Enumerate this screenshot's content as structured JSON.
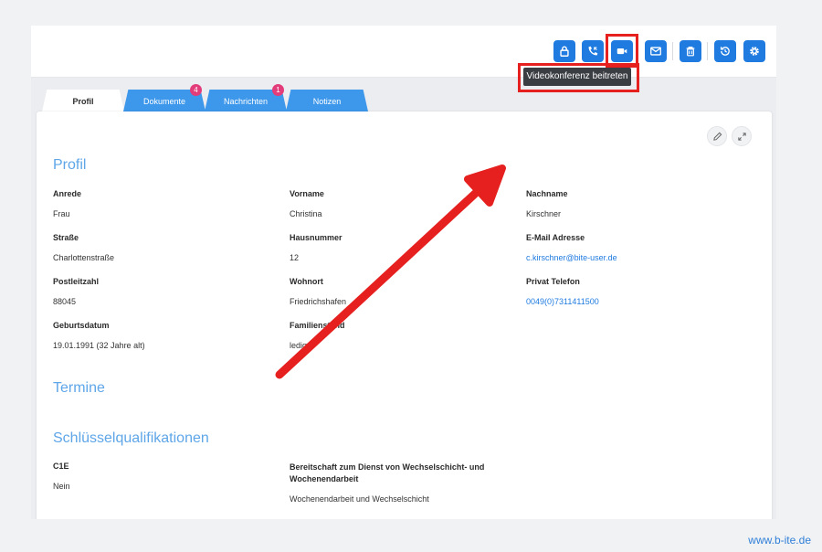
{
  "toolbar": {
    "buttons": [
      {
        "name": "lock"
      },
      {
        "name": "phone"
      },
      {
        "name": "video"
      },
      {
        "name": "mail"
      },
      {
        "name": "trash"
      },
      {
        "name": "history"
      },
      {
        "name": "settings"
      }
    ],
    "tooltip": "Videokonferenz beitreten",
    "accent": "#1f7be0",
    "highlight": "#e5201f"
  },
  "tabs": [
    {
      "label": "Profil",
      "active": true
    },
    {
      "label": "Dokumente",
      "badge": "4"
    },
    {
      "label": "Nachrichten",
      "badge": "1"
    },
    {
      "label": "Notizen"
    }
  ],
  "profile": {
    "title": "Profil",
    "fields": {
      "anrede": {
        "label": "Anrede",
        "value": "Frau"
      },
      "vorname": {
        "label": "Vorname",
        "value": "Christina"
      },
      "nachname": {
        "label": "Nachname",
        "value": "Kirschner"
      },
      "strasse": {
        "label": "Straße",
        "value": "Charlottenstraße"
      },
      "hausnummer": {
        "label": "Hausnummer",
        "value": "12"
      },
      "email": {
        "label": "E-Mail Adresse",
        "value": "c.kirschner@bite-user.de"
      },
      "plz": {
        "label": "Postleitzahl",
        "value": "88045"
      },
      "wohnort": {
        "label": "Wohnort",
        "value": "Friedrichshafen"
      },
      "telefon": {
        "label": "Privat Telefon",
        "value": "0049(0)7311411500"
      },
      "geburtsdatum": {
        "label": "Geburtsdatum",
        "value": "19.01.1991 (32 Jahre alt)"
      },
      "familienstand": {
        "label": "Familienstand",
        "value": "ledig"
      }
    }
  },
  "termine": {
    "title": "Termine"
  },
  "qualifikationen": {
    "title": "Schlüsselqualifikationen",
    "c1e": {
      "label": "C1E",
      "value": "Nein"
    },
    "bereitschaft": {
      "label": "Bereitschaft zum Dienst von Wechselschicht- und Wochenendarbeit",
      "value": "Wochenendarbeit und Wechselschicht"
    }
  },
  "footer": {
    "url": "www.b-ite.de"
  }
}
